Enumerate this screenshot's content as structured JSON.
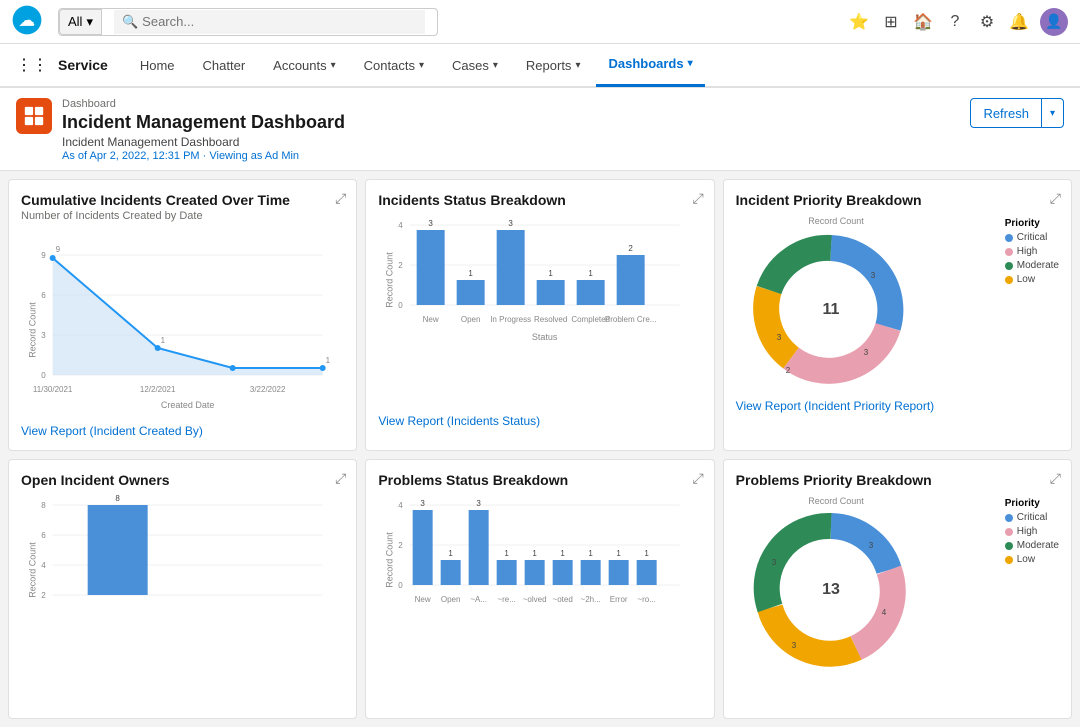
{
  "topbar": {
    "all_label": "All",
    "search_placeholder": "Search...",
    "icons": [
      "star",
      "grid",
      "home",
      "question",
      "gear",
      "bell",
      "avatar"
    ]
  },
  "nav": {
    "app_name": "Service",
    "items": [
      {
        "label": "Home",
        "active": false,
        "has_dropdown": false
      },
      {
        "label": "Chatter",
        "active": false,
        "has_dropdown": false
      },
      {
        "label": "Accounts",
        "active": false,
        "has_dropdown": true
      },
      {
        "label": "Contacts",
        "active": false,
        "has_dropdown": true
      },
      {
        "label": "Cases",
        "active": false,
        "has_dropdown": true
      },
      {
        "label": "Reports",
        "active": false,
        "has_dropdown": true
      },
      {
        "label": "Dashboards",
        "active": true,
        "has_dropdown": true
      }
    ]
  },
  "header": {
    "breadcrumb": "Dashboard",
    "title": "Incident Management Dashboard",
    "subtitle": "Incident Management Dashboard",
    "meta": "As of Apr 2, 2022, 12:31 PM · Viewing as Ad Min",
    "refresh_label": "Refresh"
  },
  "cards": [
    {
      "id": "cumulative-incidents",
      "title": "Cumulative Incidents Created Over Time",
      "subtitle": "Number of Incidents Created by Date",
      "link": "View Report (Incident Created By)",
      "type": "line"
    },
    {
      "id": "incidents-status",
      "title": "Incidents Status Breakdown",
      "subtitle": "",
      "link": "View Report (Incidents Status)",
      "type": "bar",
      "x_label": "Status",
      "y_label": "Record Count",
      "bars": [
        {
          "label": "New",
          "value": 3
        },
        {
          "label": "Open",
          "value": 1
        },
        {
          "label": "In Progress",
          "value": 3
        },
        {
          "label": "Resolved",
          "value": 1
        },
        {
          "label": "Completed",
          "value": 1
        },
        {
          "label": "Problem Cre...",
          "value": 2
        }
      ]
    },
    {
      "id": "incident-priority",
      "title": "Incident Priority Breakdown",
      "subtitle": "",
      "link": "View Report (Incident Priority Report)",
      "type": "donut",
      "center_value": "11",
      "legend_title": "Priority",
      "legend": [
        {
          "label": "Critical",
          "color": "#4a90d9"
        },
        {
          "label": "High",
          "color": "#e8a0b0"
        },
        {
          "label": "Moderate",
          "color": "#2e8b57"
        },
        {
          "label": "Low",
          "color": "#f0a500"
        }
      ],
      "segments": [
        {
          "label": "3",
          "color": "#4a90d9",
          "value": 3
        },
        {
          "label": "3",
          "color": "#e8a0b0",
          "value": 3
        },
        {
          "label": "2",
          "color": "#f0a500",
          "value": 2
        },
        {
          "label": "3",
          "color": "#2e8b57",
          "value": 3
        }
      ]
    },
    {
      "id": "open-incident-owners",
      "title": "Open Incident Owners",
      "subtitle": "",
      "link": "",
      "type": "bar_single",
      "bars": [
        {
          "label": "",
          "value": 8
        }
      ],
      "y_max": 8
    },
    {
      "id": "problems-status",
      "title": "Problems Status Breakdown",
      "subtitle": "",
      "link": "",
      "type": "bar",
      "x_label": "Status",
      "y_label": "Record Count",
      "bars": [
        {
          "label": "New",
          "value": 3
        },
        {
          "label": "Open",
          "value": 1
        },
        {
          "label": "~A...",
          "value": 3
        },
        {
          "label": "~re...",
          "value": 1
        },
        {
          "label": "~olved",
          "value": 1
        },
        {
          "label": "~oted",
          "value": 1
        },
        {
          "label": "~2h...",
          "value": 1
        },
        {
          "label": "Error",
          "value": 1
        },
        {
          "label": "~ro...",
          "value": 1
        }
      ]
    },
    {
      "id": "problems-priority",
      "title": "Problems Priority Breakdown",
      "subtitle": "",
      "link": "",
      "type": "donut",
      "center_value": "13",
      "legend_title": "Priority",
      "legend": [
        {
          "label": "Critical",
          "color": "#4a90d9"
        },
        {
          "label": "High",
          "color": "#e8a0b0"
        },
        {
          "label": "Moderate",
          "color": "#2e8b57"
        },
        {
          "label": "Low",
          "color": "#f0a500"
        }
      ],
      "segments": [
        {
          "label": "3",
          "color": "#4a90d9",
          "value": 3
        },
        {
          "label": "4",
          "color": "#e8a0b0",
          "value": 4
        },
        {
          "label": "3",
          "color": "#f0a500",
          "value": 3
        },
        {
          "label": "3",
          "color": "#2e8b57",
          "value": 3
        }
      ]
    }
  ]
}
